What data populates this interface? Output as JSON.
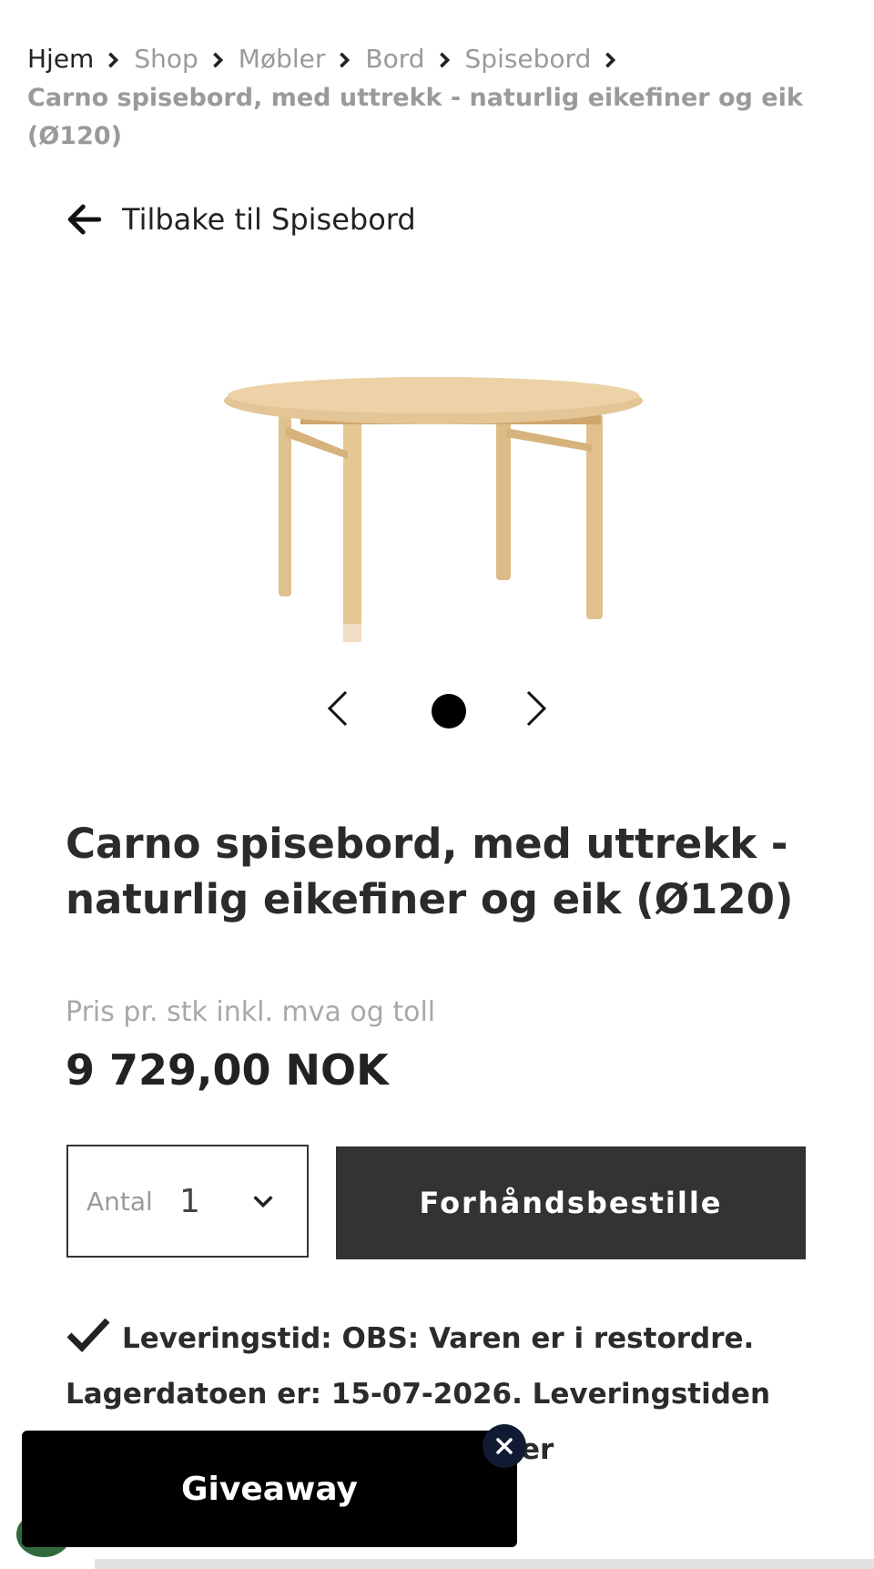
{
  "breadcrumb": {
    "items": [
      "Hjem",
      "Shop",
      "Møbler",
      "Bord",
      "Spisebord"
    ],
    "current": "Carno spisebord, med uttrekk - naturlig eikefiner og eik (Ø120)"
  },
  "back_link": {
    "label": "Tilbake til Spisebord"
  },
  "carousel": {
    "active_index": 1,
    "total": 1
  },
  "product": {
    "title": "Carno spisebord, med uttrekk - naturlig eikefiner og eik (Ø120)",
    "price_label": "Pris pr. stk inkl. mva og toll",
    "price": "9 729,00 NOK"
  },
  "quantity": {
    "label": "Antal",
    "value": "1"
  },
  "preorder_button": {
    "label": "Forhåndsbestille"
  },
  "delivery": {
    "text": "Leveringstid: OBS: Varen er i restordre. Lagerdatoen er: 15-07-2026. Leveringstiden",
    "visible_tail": "er"
  },
  "giveaway": {
    "label": "Giveaway"
  },
  "colors": {
    "button_bg": "#333333",
    "giveaway_bg": "#000000",
    "close_bg": "#111a33",
    "wood": "#e3c596"
  },
  "icons": [
    "chevron-right-icon",
    "arrow-left-icon",
    "chevron-left-icon",
    "chevron-down-icon",
    "checkmark-icon",
    "close-icon"
  ]
}
